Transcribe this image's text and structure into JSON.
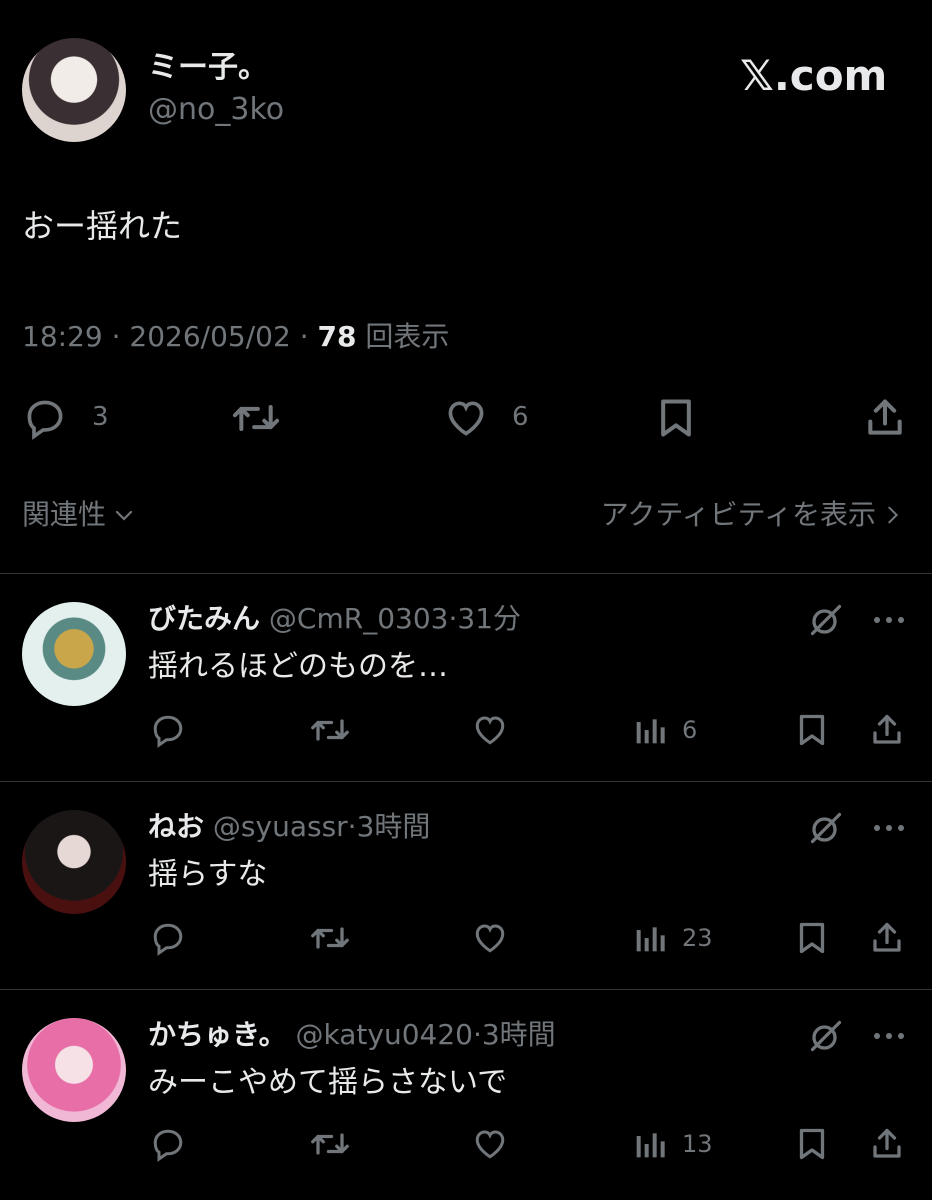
{
  "post": {
    "author_name": "ミー子。",
    "author_handle": "@no_3ko",
    "brand": "𝕏.com",
    "text": "おー揺れた",
    "time": "18:29",
    "sep": "·",
    "date": "2026/05/02",
    "views_count": "78",
    "views_label": "回表示",
    "stats": {
      "replies": "3",
      "likes": "6"
    }
  },
  "sort": {
    "label": "関連性",
    "activity_label": "アクティビティを表示"
  },
  "replies": [
    {
      "name": "びたみん",
      "handle": "@CmR_0303",
      "sep": "·",
      "time": "31分",
      "text": "揺れるほどのものを…",
      "views": "6"
    },
    {
      "name": "ねお",
      "handle": "@syuassr",
      "sep": "·",
      "time": "3時間",
      "text": "揺らすな",
      "views": "23"
    },
    {
      "name": "かちゅき。",
      "handle": "@katyu0420",
      "sep": "·",
      "time": "3時間",
      "text": "みーこやめて揺らさないで",
      "views": "13"
    }
  ],
  "colors": {
    "background": "#000000",
    "text": "#e7e9ea",
    "muted": "#71767b",
    "divider": "#2f3336"
  }
}
